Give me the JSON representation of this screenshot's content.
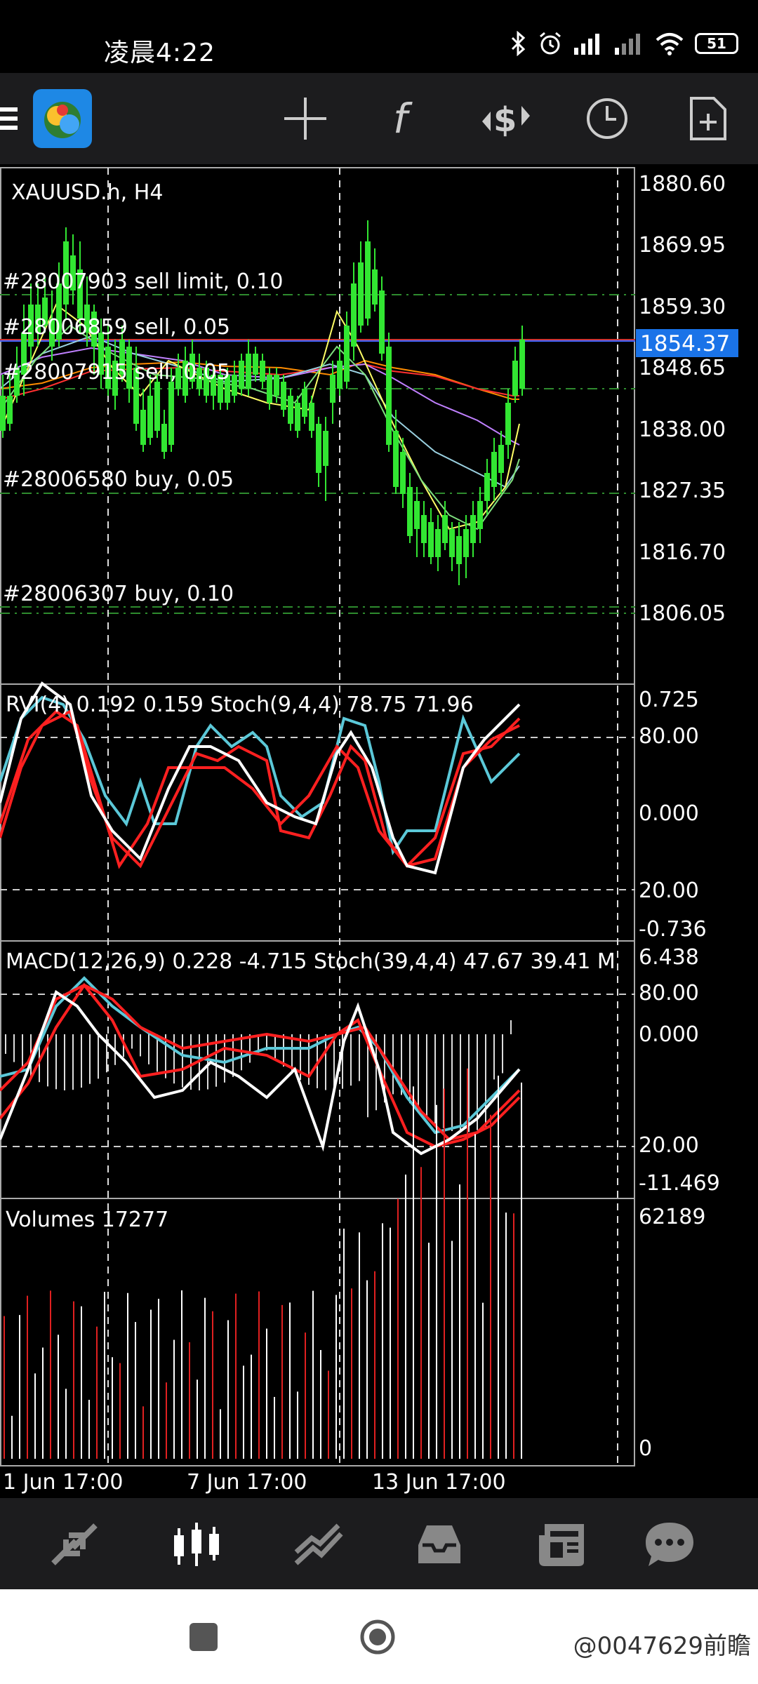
{
  "status": {
    "time": "凌晨4:22",
    "battery": "51"
  },
  "chart": {
    "symbol": "XAUUSD.h, H4",
    "price_axis": [
      "1880.60",
      "1869.95",
      "1859.30",
      "1848.65",
      "1838.00",
      "1827.35",
      "1816.70",
      "1806.05"
    ],
    "current_price": "1854.37",
    "orders": [
      "#28007903 sell limit, 0.10",
      "#28006859 sell, 0.05",
      "#28007915 sell, 0.05",
      "#28006580 buy, 0.05",
      "#28006307 buy, 0.10"
    ],
    "rvi_label": "RVI(4) 0.192 0.159 Stoch(9,4,4) 78.75 71.96",
    "rvi_axis": [
      "0.725",
      "80.00",
      "0.000",
      "20.00",
      "-0.736"
    ],
    "macd_label": "MACD(12,26,9) 0.228 -4.715 Stoch(39,4,4) 47.67 39.41 M",
    "macd_axis": [
      "6.438",
      "80.00",
      "0.000",
      "20.00",
      "-11.469"
    ],
    "volume_label": "Volumes 17277",
    "volume_axis": [
      "62189",
      "0"
    ],
    "time_axis": [
      "1 Jun 17:00",
      "7 Jun 17:00",
      "13 Jun 17:00"
    ]
  },
  "watermark": "@0047629前瞻"
}
